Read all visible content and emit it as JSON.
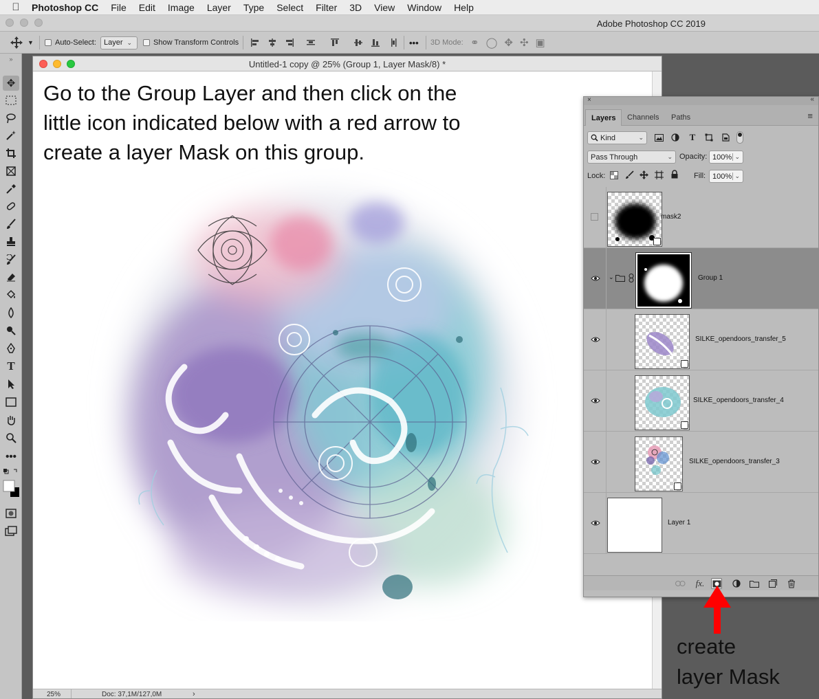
{
  "menubar": {
    "app_name": "Photoshop CC",
    "items": [
      "File",
      "Edit",
      "Image",
      "Layer",
      "Type",
      "Select",
      "Filter",
      "3D",
      "View",
      "Window",
      "Help"
    ]
  },
  "app_title": "Adobe Photoshop CC 2019",
  "options": {
    "auto_select_label": "Auto-Select:",
    "auto_select_value": "Layer",
    "show_transform_label": "Show Transform Controls",
    "more": "•••",
    "mode_3d_label": "3D Mode:"
  },
  "document": {
    "title": "Untitled-1 copy @ 25% (Group 1, Layer Mask/8) *",
    "instruction": "Go to the Group Layer and then click on the little icon indicated below with a red arrow to create a layer Mask on this group.",
    "zoom": "25%",
    "doc_size": "Doc: 37,1M/127,0M"
  },
  "layers_panel": {
    "tabs": [
      "Layers",
      "Channels",
      "Paths"
    ],
    "filter_kind": "Kind",
    "blend_mode": "Pass Through",
    "opacity_label": "Opacity:",
    "opacity_value": "100%",
    "lock_label": "Lock:",
    "fill_label": "Fill:",
    "fill_value": "100%",
    "filter_icons": [
      "T"
    ],
    "layers": [
      {
        "name": "mask2",
        "visible": false
      },
      {
        "name": "Group 1",
        "visible": true,
        "selected": true
      },
      {
        "name": "SILKE_opendoors_transfer_5",
        "visible": true
      },
      {
        "name": "SILKE_opendoors_transfer_4",
        "visible": true
      },
      {
        "name": "SILKE_opendoors_transfer_3",
        "visible": true
      },
      {
        "name": "Layer 1",
        "visible": true
      }
    ],
    "bottom_fx": "fx."
  },
  "annotation": {
    "line1": "create",
    "line2": "layer Mask",
    "arrow_color": "#ff0000"
  },
  "colors": {
    "accent_red": "#ff0000",
    "selected_row": "#8c8c8c"
  }
}
